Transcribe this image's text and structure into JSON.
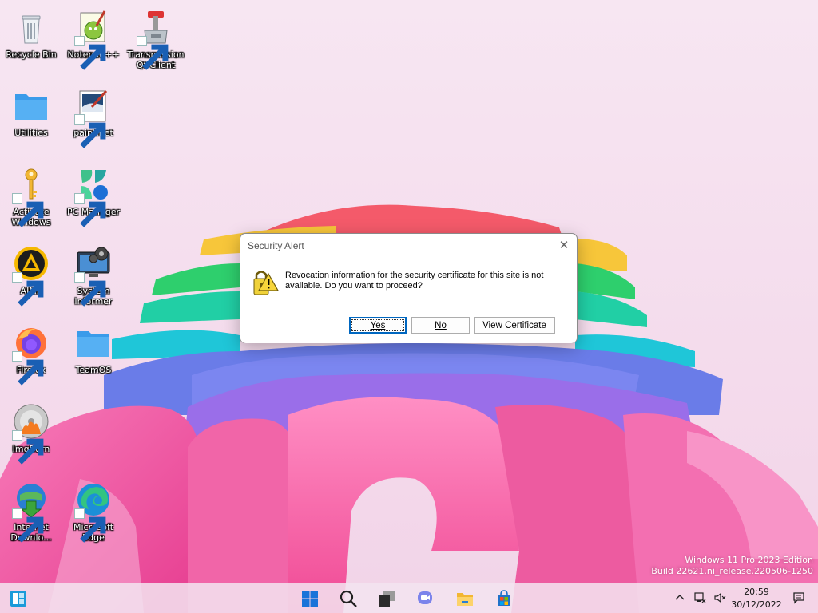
{
  "desktop": {
    "icons": [
      {
        "label": "Recycle Bin",
        "icon": "recycle-bin-icon"
      },
      {
        "label": "Notepad++",
        "icon": "notepad-plus-plus-icon"
      },
      {
        "label": "Transmission Qt Client",
        "icon": "transmission-icon"
      },
      {
        "label": "Utilities",
        "icon": "folder-icon"
      },
      {
        "label": "paint.net",
        "icon": "paint-net-icon"
      },
      {
        "label": "Activate Windows",
        "icon": "key-icon"
      },
      {
        "label": "PC Manager",
        "icon": "pc-manager-icon"
      },
      {
        "label": "AIMP",
        "icon": "aimp-icon"
      },
      {
        "label": "System Informer",
        "icon": "system-informer-icon"
      },
      {
        "label": "Firefox",
        "icon": "firefox-icon"
      },
      {
        "label": "TeamOS",
        "icon": "folder-icon"
      },
      {
        "label": "ImgBurn",
        "icon": "imgburn-icon"
      },
      {
        "label": "Internet Downlo...",
        "icon": "internet-download-manager-icon"
      },
      {
        "label": "Microsoft Edge",
        "icon": "edge-icon"
      }
    ]
  },
  "dialog": {
    "title": "Security Alert",
    "message": "Revocation information for the security certificate for this site is not available. Do you want to proceed?",
    "buttons": {
      "yes": "Yes",
      "no": "No",
      "view_certificate": "View Certificate"
    },
    "close_glyph": "✕",
    "icon": "security-warning-icon"
  },
  "watermark": {
    "line1": "Windows 11 Pro 2023 Edition",
    "line2": "Build 22621.ni_release.220506-1250"
  },
  "taskbar": {
    "items": [
      "widgets-icon",
      "start-icon",
      "search-icon",
      "task-view-icon",
      "chat-icon",
      "file-explorer-icon",
      "microsoft-store-icon"
    ],
    "tray": [
      "chevron-up-icon",
      "network-icon",
      "speaker-muted-icon",
      "notifications-icon"
    ],
    "time": "20:59",
    "date": "30/12/2022"
  },
  "colors": {
    "accent": "#0067c0",
    "start_blue": "#1a73d9"
  }
}
